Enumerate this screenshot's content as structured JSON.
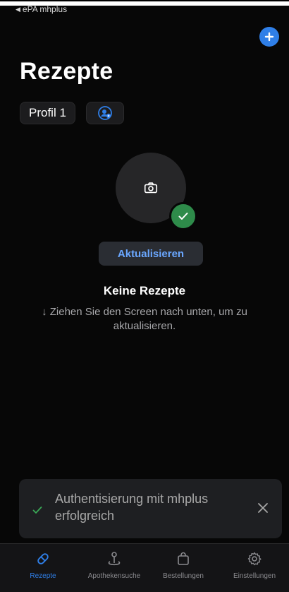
{
  "status_bar": {
    "back_label": "ePA mhplus"
  },
  "header": {
    "title": "Rezepte"
  },
  "profiles": {
    "selected": "Profil 1"
  },
  "actions": {
    "refresh_label": "Aktualisieren"
  },
  "empty_state": {
    "title": "Keine Rezepte",
    "hint": "↓ Ziehen Sie den Screen nach unten, um zu aktualisieren."
  },
  "toast": {
    "message": "Authentisierung mit mhplus erfolgreich"
  },
  "tabbar": {
    "tabs": [
      {
        "label": "Rezepte",
        "icon": "pill-icon",
        "active": true
      },
      {
        "label": "Apothekensuche",
        "icon": "map-pin-icon",
        "active": false
      },
      {
        "label": "Bestellungen",
        "icon": "bag-icon",
        "active": false
      },
      {
        "label": "Einstellungen",
        "icon": "gear-icon",
        "active": false
      }
    ]
  },
  "colors": {
    "accent": "#2f7fe8",
    "success": "#2e8b4a",
    "background": "#070707"
  }
}
